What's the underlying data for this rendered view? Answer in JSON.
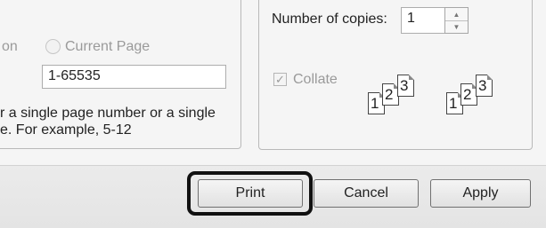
{
  "page_range": {
    "selection_label_partial": "on",
    "current_page_label": "Current Page",
    "pages_value": "1-65535",
    "hint_line1": "r a single page number or a single",
    "hint_line2": "e.  For example, 5-12"
  },
  "copies": {
    "number_label": "Number of copies:",
    "number_value": "1",
    "collate_label": "Collate",
    "collate_checked": true,
    "collate_icon_pages": [
      "1",
      "2",
      "3"
    ]
  },
  "buttons": {
    "print": "Print",
    "cancel": "Cancel",
    "apply": "Apply"
  }
}
